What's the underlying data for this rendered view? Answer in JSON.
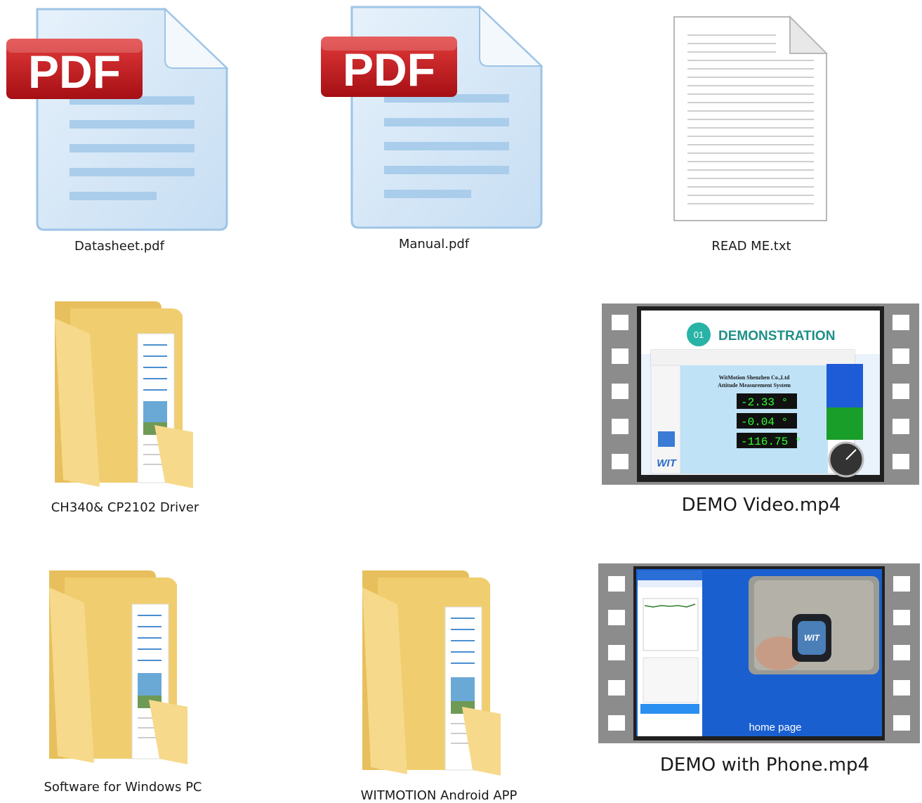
{
  "files": [
    {
      "name": "Datasheet.pdf",
      "type": "pdf",
      "icon": "pdf-file-icon",
      "badge": "PDF"
    },
    {
      "name": "Manual.pdf",
      "type": "pdf",
      "icon": "pdf-file-icon",
      "badge": "PDF"
    },
    {
      "name": "READ ME.txt",
      "type": "txt",
      "icon": "text-file-icon"
    },
    {
      "name": "CH340& CP2102 Driver",
      "type": "folder",
      "icon": "folder-icon"
    },
    {
      "name": "DEMO Video.mp4",
      "type": "video",
      "icon": "video-file-icon",
      "thumbnail": {
        "badge": "01",
        "title": "DEMONSTRATION",
        "company_line1": "WitMotion Shenzhen Co.,Ltd",
        "company_line2": "Attitude Measurement System",
        "readouts": [
          "-2.33 °",
          "-0.04 °",
          "-116.75 °"
        ],
        "logo": "WIT"
      }
    },
    {
      "name": "Software for Windows PC",
      "type": "folder",
      "icon": "folder-icon"
    },
    {
      "name": "WITMOTION Android APP",
      "type": "folder",
      "icon": "folder-icon"
    },
    {
      "name": "DEMO with Phone.mp4",
      "type": "video",
      "icon": "video-file-icon",
      "thumbnail": {
        "caption": "home page",
        "device_logo": "WIT"
      }
    }
  ],
  "colors": {
    "pdf_badge": "#c8161b",
    "pdf_page": "#dcebf8",
    "pdf_line": "#a9cdea",
    "folder": "#f4d47c",
    "filmstrip": "#8c8c8c",
    "video_blue": "#1a5fd0",
    "readout_green": "#33ff33"
  }
}
